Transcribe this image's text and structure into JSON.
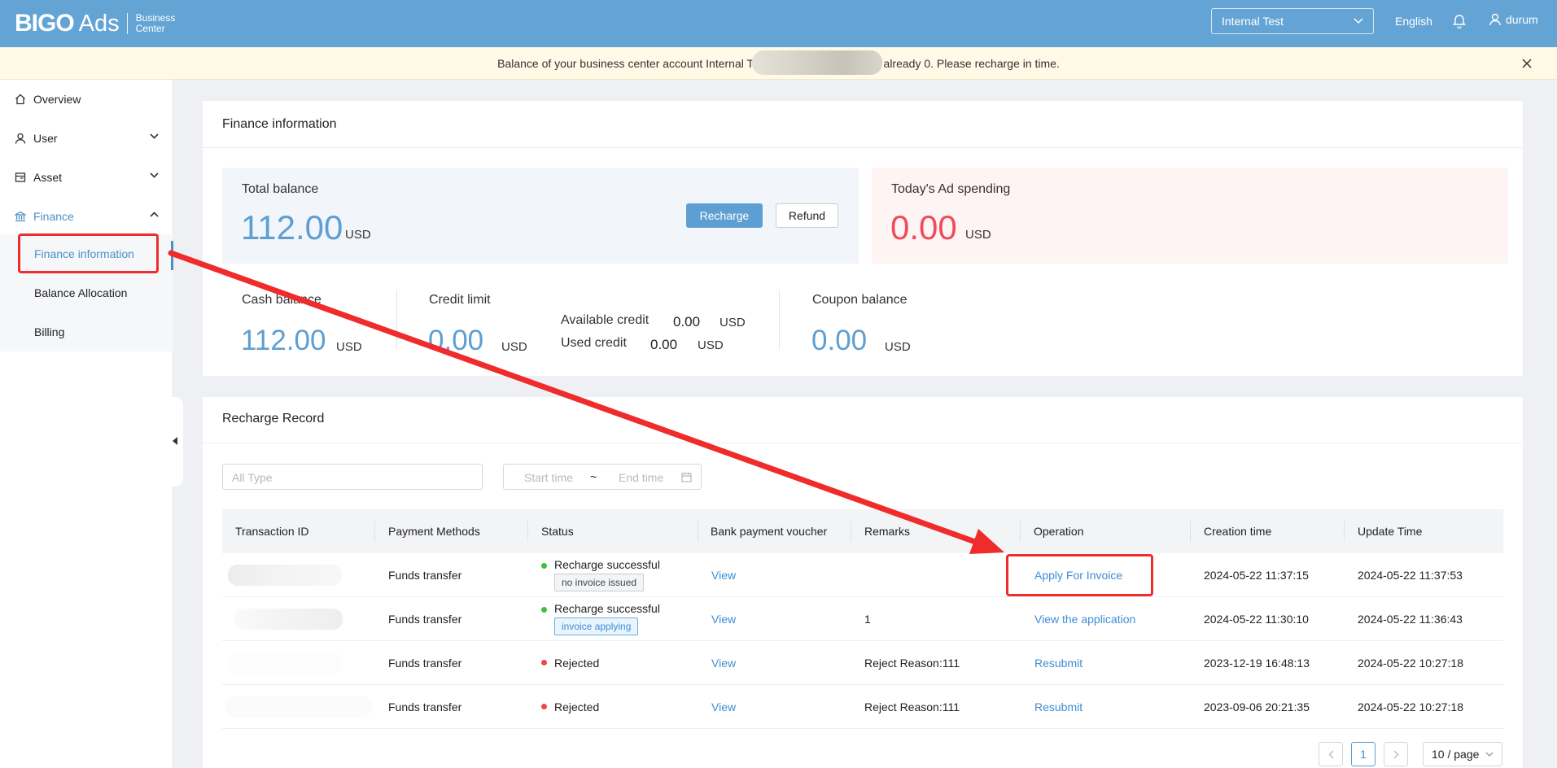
{
  "header": {
    "logo_bigo": "BIGO",
    "logo_ads": "Ads",
    "logo_bc_line1": "Business",
    "logo_bc_line2": "Center",
    "account_select": "Internal Test",
    "language": "English",
    "username": "durum"
  },
  "notice": {
    "text": "Balance of your business center account Internal Tes                                  is already 0. Please recharge in time."
  },
  "sidebar": {
    "items": [
      {
        "label": "Overview",
        "icon": "home-icon"
      },
      {
        "label": "User",
        "icon": "user-icon"
      },
      {
        "label": "Asset",
        "icon": "asset-icon"
      },
      {
        "label": "Finance",
        "icon": "bank-icon"
      }
    ],
    "finance_sub": [
      {
        "label": "Finance information"
      },
      {
        "label": "Balance Allocation"
      },
      {
        "label": "Billing"
      }
    ]
  },
  "finance_info": {
    "title": "Finance information",
    "total_balance": {
      "label": "Total balance",
      "value": "112.00",
      "unit": "USD"
    },
    "recharge_button": "Recharge",
    "refund_button": "Refund",
    "ad_spending": {
      "label": "Today's Ad spending",
      "value": "0.00",
      "unit": "USD"
    },
    "cash_balance": {
      "label": "Cash balance",
      "value": "112.00",
      "unit": "USD"
    },
    "credit_limit": {
      "label": "Credit limit",
      "value": "0.00",
      "unit": "USD"
    },
    "available_credit": {
      "label": "Available credit",
      "value": "0.00",
      "unit": "USD"
    },
    "used_credit": {
      "label": "Used credit",
      "value": "0.00",
      "unit": "USD"
    },
    "coupon_balance": {
      "label": "Coupon balance",
      "value": "0.00",
      "unit": "USD"
    }
  },
  "recharge_record": {
    "title": "Recharge Record",
    "type_placeholder": "All Type",
    "start_placeholder": "Start time",
    "range_sep": "~",
    "end_placeholder": "End time",
    "columns": [
      "Transaction ID",
      "Payment Methods",
      "Status",
      "Bank payment voucher",
      "Remarks",
      "Operation",
      "Creation time",
      "Update Time"
    ],
    "rows": [
      {
        "payment": "Funds transfer",
        "status": "Recharge successful",
        "status_color": "#3cc13b",
        "tag": "no invoice issued",
        "voucher": "View",
        "remarks": "",
        "operation": "Apply For Invoice",
        "created": "2024-05-22 11:37:15",
        "updated": "2024-05-22 11:37:53"
      },
      {
        "payment": "Funds transfer",
        "status": "Recharge successful",
        "status_color": "#3cc13b",
        "tag": "invoice applying",
        "voucher": "View",
        "remarks": "1",
        "operation": "View the application",
        "created": "2024-05-22 11:30:10",
        "updated": "2024-05-22 11:36:43"
      },
      {
        "payment": "Funds transfer",
        "status": "Rejected",
        "status_color": "#f04848",
        "tag": "",
        "voucher": "View",
        "remarks": "Reject Reason:111",
        "operation": "Resubmit",
        "created": "2023-12-19 16:48:13",
        "updated": "2024-05-22 10:27:18"
      },
      {
        "payment": "Funds transfer",
        "status": "Rejected",
        "status_color": "#f04848",
        "tag": "",
        "voucher": "View",
        "remarks": "Reject Reason:111",
        "operation": "Resubmit",
        "created": "2023-09-06 20:21:35",
        "updated": "2024-05-22 10:27:18"
      }
    ],
    "pagination": {
      "current_page": "1",
      "page_size": "10 / page"
    }
  },
  "colors": {
    "header_bg": "#64a4d4",
    "accent": "#5d9fd3",
    "spending_red": "#f04b5a",
    "annotation_red": "#ef2b2b"
  }
}
